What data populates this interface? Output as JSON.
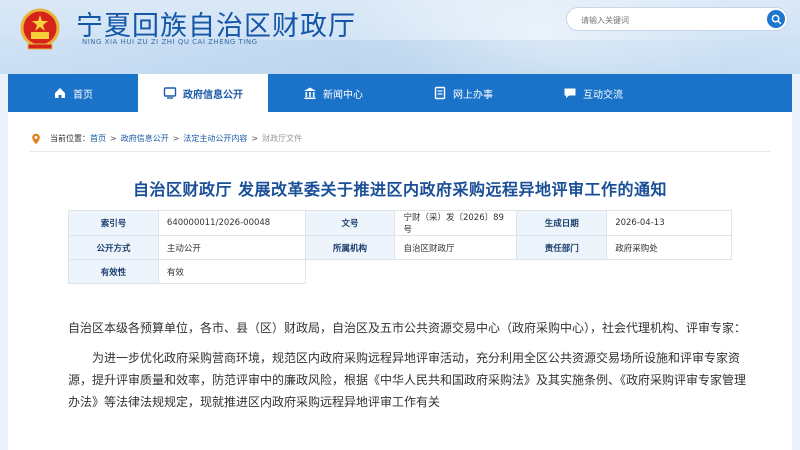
{
  "header": {
    "title": "宁夏回族自治区财政厅",
    "subtitle": "NING XIA HUI ZU ZI ZHI QU CAI ZHENG TING",
    "search_placeholder": "请输入关键词",
    "brand_color": "#1a73c9"
  },
  "nav": {
    "items": [
      {
        "label": "首页",
        "icon": "home-icon"
      },
      {
        "label": "政府信息公开",
        "icon": "monitor-icon",
        "active": true
      },
      {
        "label": "新闻中心",
        "icon": "building-icon"
      },
      {
        "label": "网上办事",
        "icon": "document-icon"
      },
      {
        "label": "互动交流",
        "icon": "chat-icon"
      }
    ]
  },
  "breadcrumb": {
    "prefix": "当前位置：",
    "items": [
      "首页",
      "政府信息公开",
      "法定主动公开内容",
      "财政厅文件"
    ]
  },
  "document": {
    "title": "自治区财政厅 发展改革委关于推进区内政府采购远程异地评审工作的通知",
    "meta": {
      "index_label": "索引号",
      "index_value": "640000011/2026-00048",
      "doc_no_label": "文号",
      "doc_no_value": "宁财（采）发〔2026〕89号",
      "date_label": "生成日期",
      "date_value": "2026-04-13",
      "open_label": "公开方式",
      "open_value": "主动公开",
      "org_label": "所属机构",
      "org_value": "自治区财政厅",
      "dept_label": "责任部门",
      "dept_value": "政府采购处",
      "valid_label": "有效性",
      "valid_value": "有效"
    },
    "para1": "自治区本级各预算单位，各市、县（区）财政局，自治区及五市公共资源交易中心（政府采购中心），社会代理机构、评审专家：",
    "para2": "为进一步优化政府采购营商环境，规范区内政府采购远程异地评审活动，充分利用全区公共资源交易场所设施和评审专家资源，提升评审质量和效率，防范评审中的廉政风险，根据《中华人民共和国政府采购法》及其实施条例、《政府采购评审专家管理办法》等法律法规规定，现就推进区内政府采购远程异地评审工作有关"
  }
}
